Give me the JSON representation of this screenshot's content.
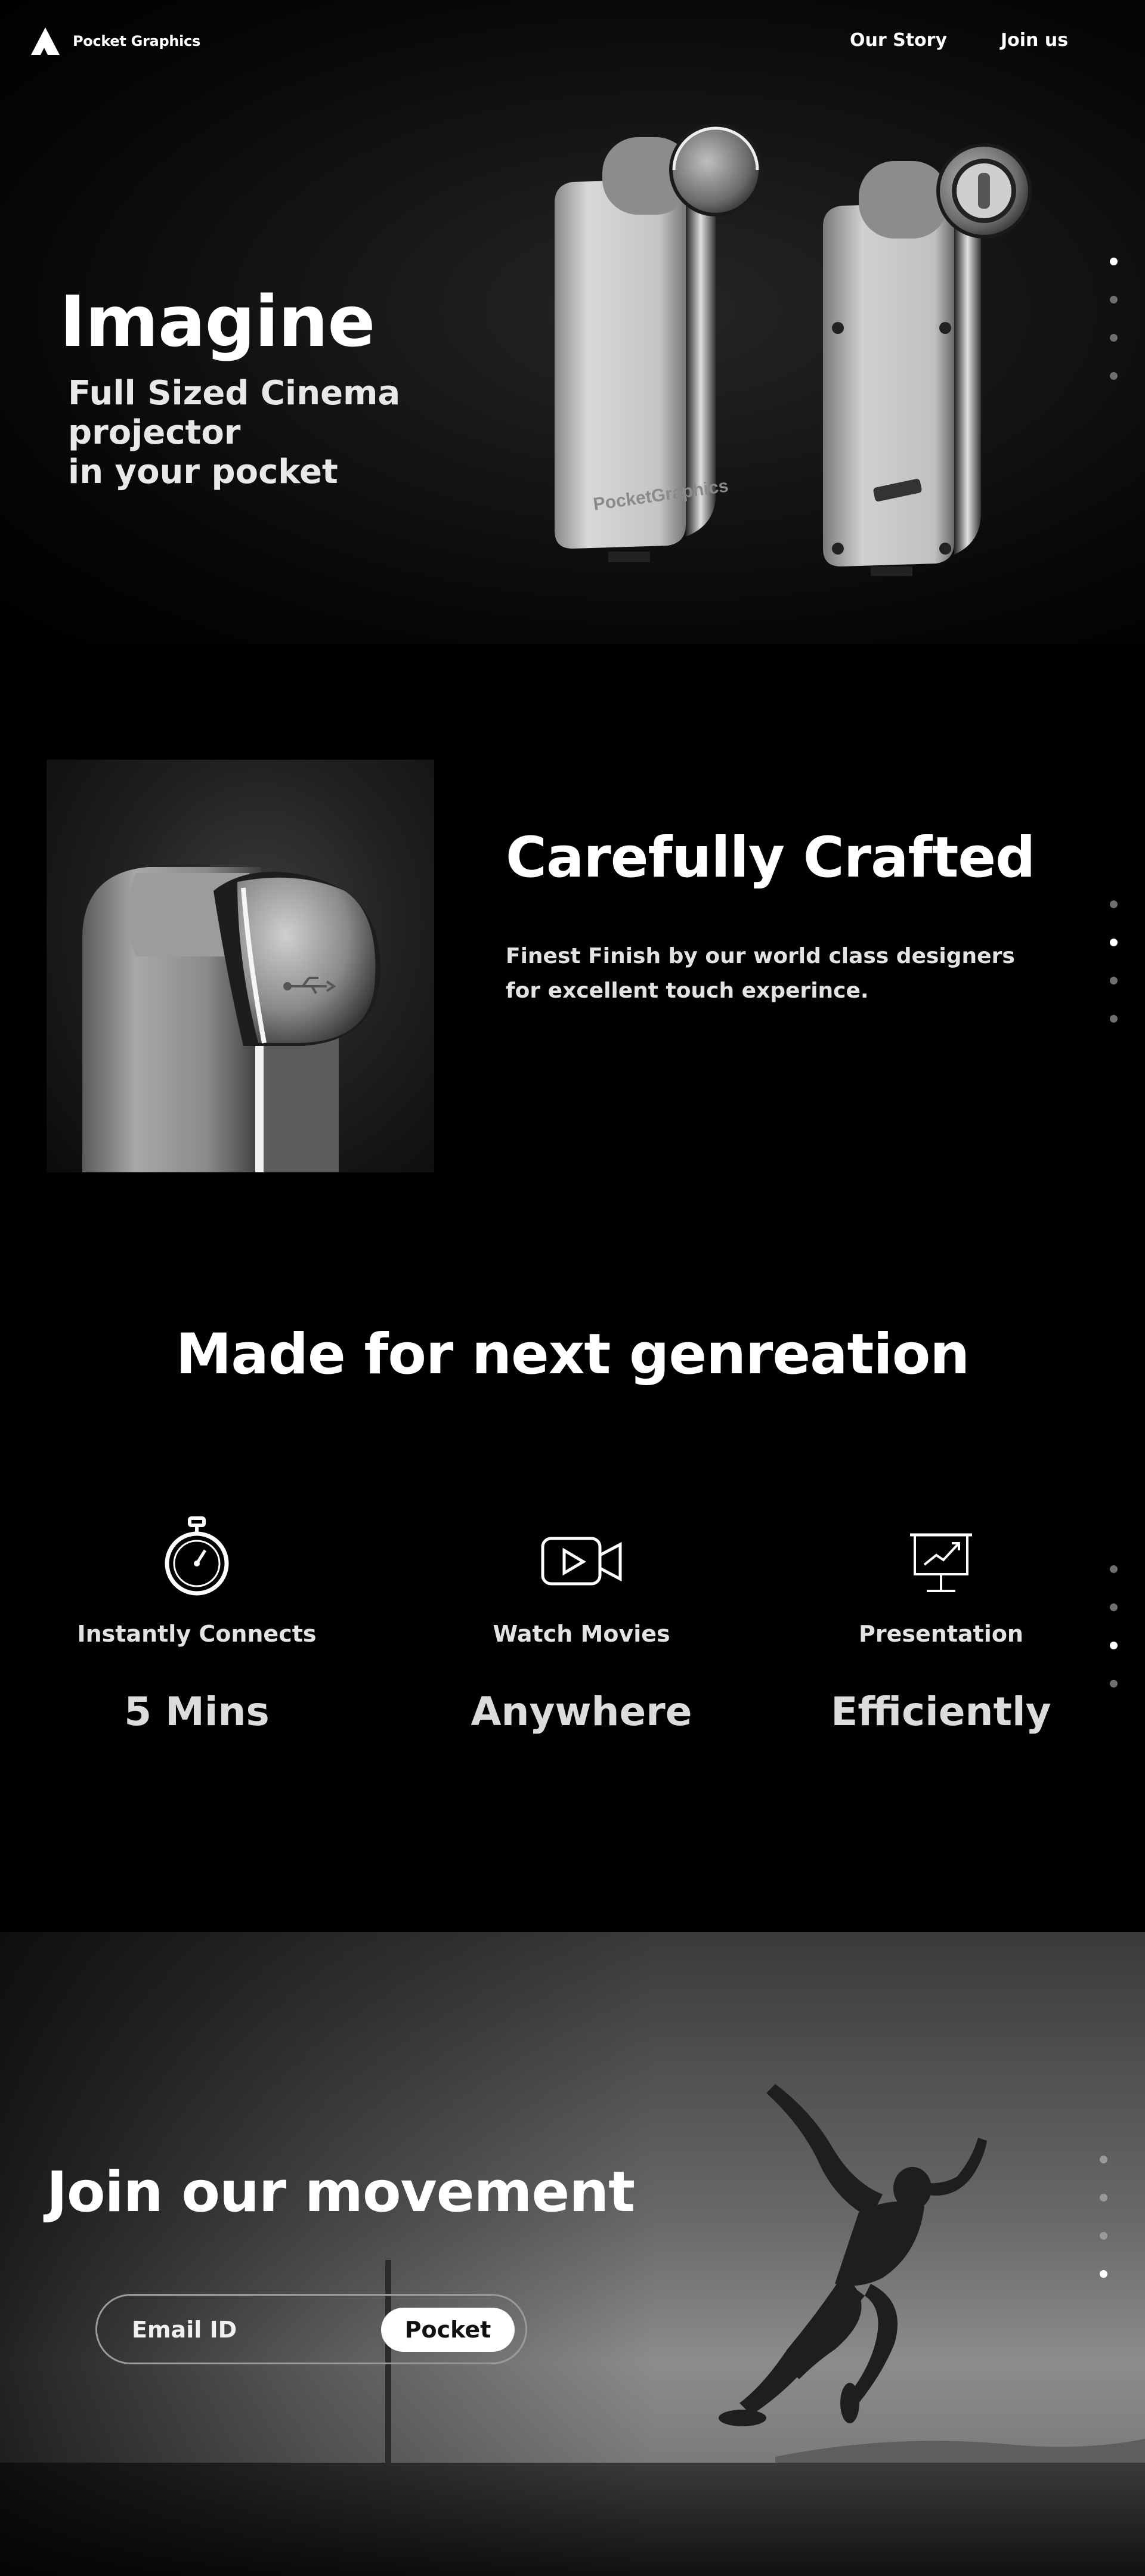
{
  "nav": {
    "brand": "Pocket Graphics",
    "links": [
      "Our Story",
      "Join us"
    ]
  },
  "hero": {
    "title": "Imagine",
    "subtitle_lines": [
      "Full Sized Cinema",
      "projector",
      "in your pocket"
    ],
    "device_label": "PocketGraphics"
  },
  "crafted": {
    "title": "Carefully Crafted",
    "description_lines": [
      "Finest Finish by our world class designers",
      "for excellent touch experince."
    ]
  },
  "features": {
    "title": "Made for next genreation",
    "items": [
      {
        "icon": "stopwatch-icon",
        "label": "Instantly Connects",
        "value": "5 Mins"
      },
      {
        "icon": "video-play-icon",
        "label": "Watch Movies",
        "value": "Anywhere"
      },
      {
        "icon": "presentation-board-icon",
        "label": "Presentation",
        "value": "Efficiently"
      }
    ]
  },
  "join": {
    "title": "Join our movement",
    "email_placeholder": "Email ID",
    "button_label": "Pocket"
  },
  "pagination": {
    "hero_active": 1,
    "crafted_active": 2,
    "features_active": 3,
    "join_active": 4
  },
  "colors": {
    "background": "#000000",
    "text": "#ffffff",
    "dot_inactive": "#6f6f6f",
    "dot_active": "#ffffff"
  }
}
